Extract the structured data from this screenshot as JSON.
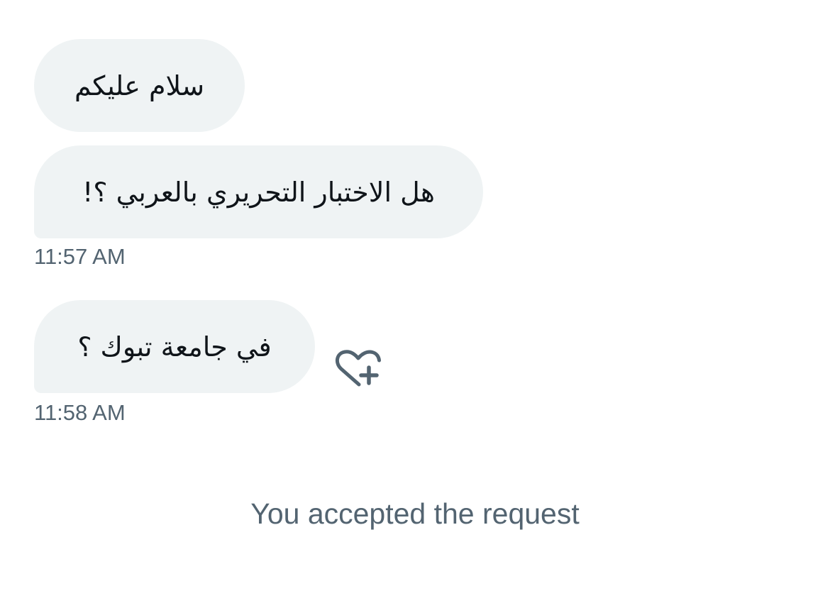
{
  "conversation": {
    "messages": [
      {
        "text": "سلام عليكم"
      },
      {
        "text": "هل الاختبار التحريري بالعربي ؟!"
      },
      {
        "text": "في جامعة تبوك ؟"
      }
    ],
    "timestamps": [
      "11:57 AM",
      "11:58 AM"
    ],
    "reaction_icon": "heart-plus-icon",
    "system_note": "You accepted the request"
  },
  "colors": {
    "bubble_background": "#eff3f4",
    "bubble_text": "#0f1419",
    "secondary_text": "#536471",
    "background": "#ffffff"
  }
}
